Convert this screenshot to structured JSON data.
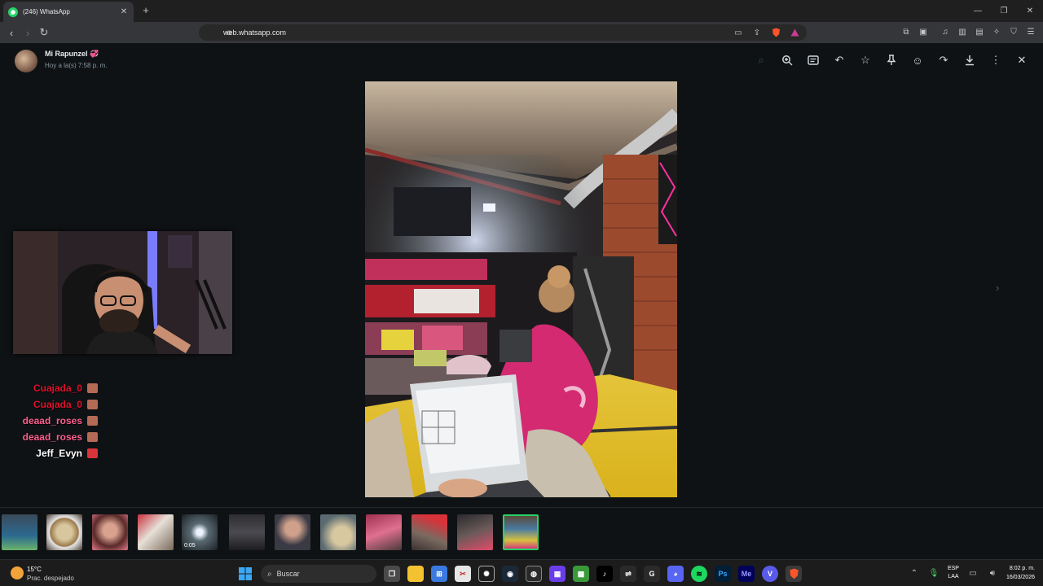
{
  "browser": {
    "tab_title": "(246) WhatsApp",
    "url": "web.whatsapp.com"
  },
  "viewer": {
    "sender_name": "Mi Rapunzel 💞",
    "sent_time": "Hoy a la(s) 7:58 p. m.",
    "actions": [
      "search-icon",
      "zoom-in-icon",
      "caption-icon",
      "reply-icon",
      "star-icon",
      "pin-icon",
      "emoji-icon",
      "forward-icon",
      "download-icon",
      "more-icon",
      "close-icon"
    ],
    "thumbnails_count": 12,
    "video_duration": "0:05"
  },
  "stream_chat": [
    {
      "name": "Cuajada_0",
      "color": "#e0102e"
    },
    {
      "name": "Cuajada_0",
      "color": "#e0102e"
    },
    {
      "name": "deaad_roses",
      "color": "#ff5f8f"
    },
    {
      "name": "deaad_roses",
      "color": "#ff5f8f"
    },
    {
      "name": "Jeff_Evyn",
      "color": "#ffffff"
    }
  ],
  "taskbar": {
    "weather_temp": "15°C",
    "weather_desc": "Prac. despejado",
    "search_label": "Buscar",
    "lang_line1": "ESP",
    "lang_line2": "LAA",
    "time": "8:02 p. m.",
    "date": "16/03/2026"
  }
}
